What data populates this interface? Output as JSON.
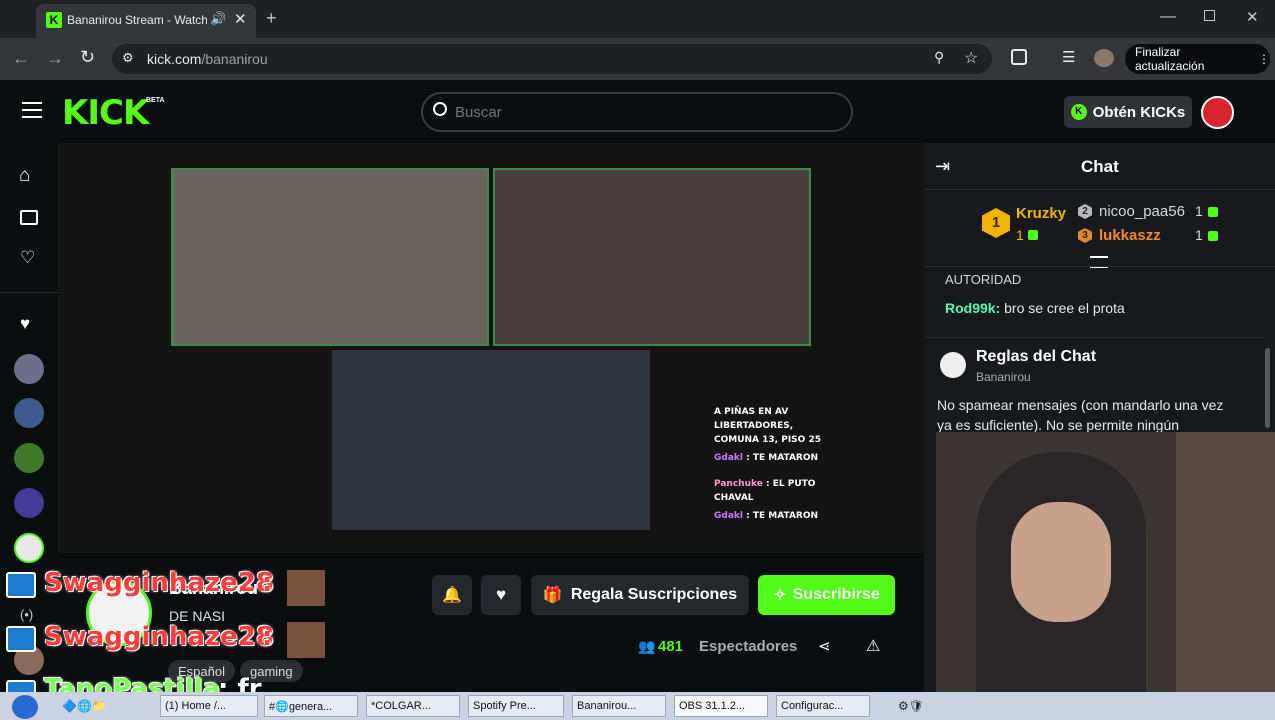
{
  "browser": {
    "tab_title": "Bananirou Stream - Watch L",
    "url_domain": "kick.com",
    "url_path": "/bananirou",
    "finish_update_label": "Finalizar actualización"
  },
  "header": {
    "logo": "KICK",
    "logo_badge": "BETA",
    "search_placeholder": "Buscar",
    "get_kicks_label": "Obtén KICKs"
  },
  "stream_overlay_chat": {
    "lines": [
      {
        "text": "A PIÑAS EN AV LIBERTADORES,"
      },
      {
        "text": "COMUNA 13, PISO 25"
      },
      {
        "user": "Gdakl",
        "text": ": TE MATARON"
      },
      {
        "user": "Panchuke",
        "text": ": EL PUTO"
      },
      {
        "text": "CHAVAL"
      },
      {
        "user": "Gdakl",
        "text": ": TE MATARON"
      }
    ]
  },
  "channel": {
    "name": "Bananirou",
    "subtitle": "DE NASI",
    "gift_subs_label": "Regala Suscripciones",
    "subscribe_label": "Suscribirse",
    "viewers_count": "481",
    "viewers_label": "Espectadores",
    "tags": [
      "Español",
      "gaming"
    ]
  },
  "chat": {
    "title": "Chat",
    "leaderboard": [
      {
        "rank": "1",
        "name": "Kruzky",
        "count": "1"
      },
      {
        "rank": "2",
        "name": "nicoo_paa56",
        "count": "1"
      },
      {
        "rank": "3",
        "name": "lukkaszz",
        "count": "1"
      }
    ],
    "partial_line": "AUTORIDAD",
    "messages": [
      {
        "user": "Rod99k:",
        "text": "bro se cree el prota"
      }
    ],
    "rules_title": "Reglas del Chat",
    "rules_owner": "Bananirou",
    "rules_text": "No spamear mensajes (con mandarlo una vez ya es suficiente). No se permite ningún"
  },
  "stream_alerts": [
    {
      "name": "Swagginhaze28",
      "suffix": ":"
    },
    {
      "name": "Swagginhaze28",
      "suffix": ":"
    },
    {
      "name": "TanoPastilla",
      "suffix": ": fr"
    }
  ],
  "taskbar": {
    "items": [
      "(1) Home /...",
      "#🌐genera...",
      "*COLGAR...",
      "Spotify Pre...",
      "Bananirou...",
      "OBS 31.1.2...",
      "Configurac..."
    ]
  },
  "colors": {
    "accent": "#53fc18",
    "background": "#0b0e0f",
    "chat_bg": "#18191c"
  }
}
